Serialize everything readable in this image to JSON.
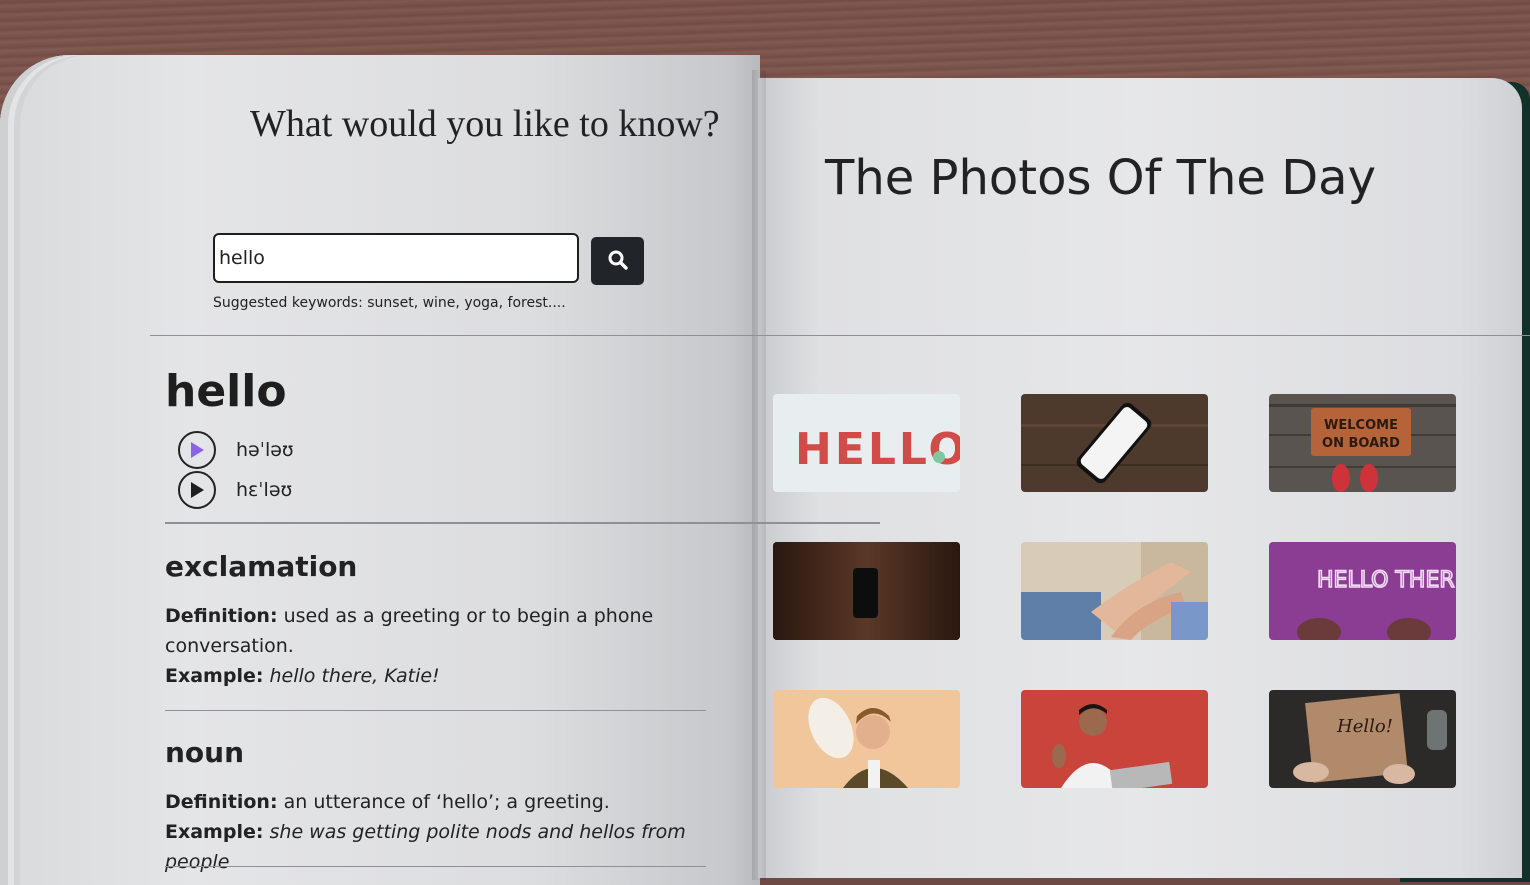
{
  "search": {
    "heading": "What would you like to know?",
    "value": "hello",
    "suggested": "Suggested keywords: sunset, wine, yoga, forest...."
  },
  "entry": {
    "word": "hello",
    "phonetics": [
      {
        "text": "həˈləʊ",
        "icon": "play-icon"
      },
      {
        "text": "hɛˈləʊ",
        "icon": "play-icon"
      }
    ],
    "meanings": [
      {
        "part_of_speech": "exclamation",
        "definition_label": "Definition:",
        "definition": "used as a greeting or to begin a phone conversation.",
        "example_label": "Example:",
        "example": "hello there, Katie!"
      },
      {
        "part_of_speech": "noun",
        "definition_label": "Definition:",
        "definition": "an utterance of ‘hello’; a greeting.",
        "example_label": "Example:",
        "example": "she was getting polite nods and hellos from people"
      }
    ]
  },
  "photos": {
    "title": "The Photos Of The Day",
    "items": [
      {
        "subject": "HELLO letters on light background",
        "text": "HELLO"
      },
      {
        "subject": "smartphone on wooden table"
      },
      {
        "subject": "welcome on board doormat with red sneakers",
        "text": "WELCOME ON BOARD"
      },
      {
        "subject": "phone on dark wood"
      },
      {
        "subject": "handshake"
      },
      {
        "subject": "neon hello there sign on purple",
        "text": "HELLO THERE"
      },
      {
        "subject": "man tipping hat"
      },
      {
        "subject": "man waving at laptop on red background"
      },
      {
        "subject": "hand lettering hello card"
      }
    ]
  },
  "colors": {
    "button_dark": "#212529",
    "active_play": "#8a63e8"
  }
}
